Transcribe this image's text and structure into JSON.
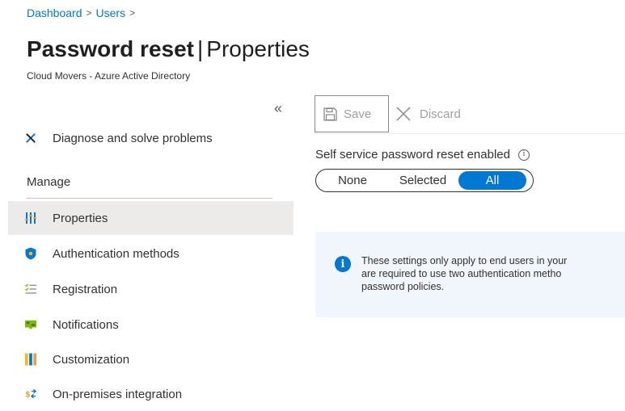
{
  "breadcrumb": {
    "items": [
      "Dashboard",
      "Users"
    ],
    "separator": ">"
  },
  "header": {
    "title_bold": "Password reset",
    "title_separator": "|",
    "title_rest": "Properties",
    "subtitle": "Cloud Movers - Azure Active Directory"
  },
  "sidebar": {
    "collapse_glyph": "«",
    "diagnose_label": "Diagnose and solve problems",
    "manage_heading": "Manage",
    "items": [
      {
        "label": "Properties",
        "icon": "properties-icon",
        "active": true
      },
      {
        "label": "Authentication methods",
        "icon": "shield-icon",
        "active": false
      },
      {
        "label": "Registration",
        "icon": "checklist-icon",
        "active": false
      },
      {
        "label": "Notifications",
        "icon": "notification-icon",
        "active": false
      },
      {
        "label": "Customization",
        "icon": "customization-icon",
        "active": false
      },
      {
        "label": "On-premises integration",
        "icon": "sync-icon",
        "active": false
      }
    ]
  },
  "toolbar": {
    "save_label": "Save",
    "discard_label": "Discard"
  },
  "sspr": {
    "label": "Self service password reset enabled",
    "info_glyph": "i",
    "options": [
      "None",
      "Selected",
      "All"
    ],
    "selected": "All"
  },
  "info_banner": {
    "icon_glyph": "i",
    "lines": [
      "These settings only apply to end users in your",
      "are required to use two authentication metho",
      "password policies."
    ]
  },
  "colors": {
    "accent": "#0078d4",
    "active_nav_bg": "#edebe9",
    "banner_bg": "#f1f5fc"
  }
}
